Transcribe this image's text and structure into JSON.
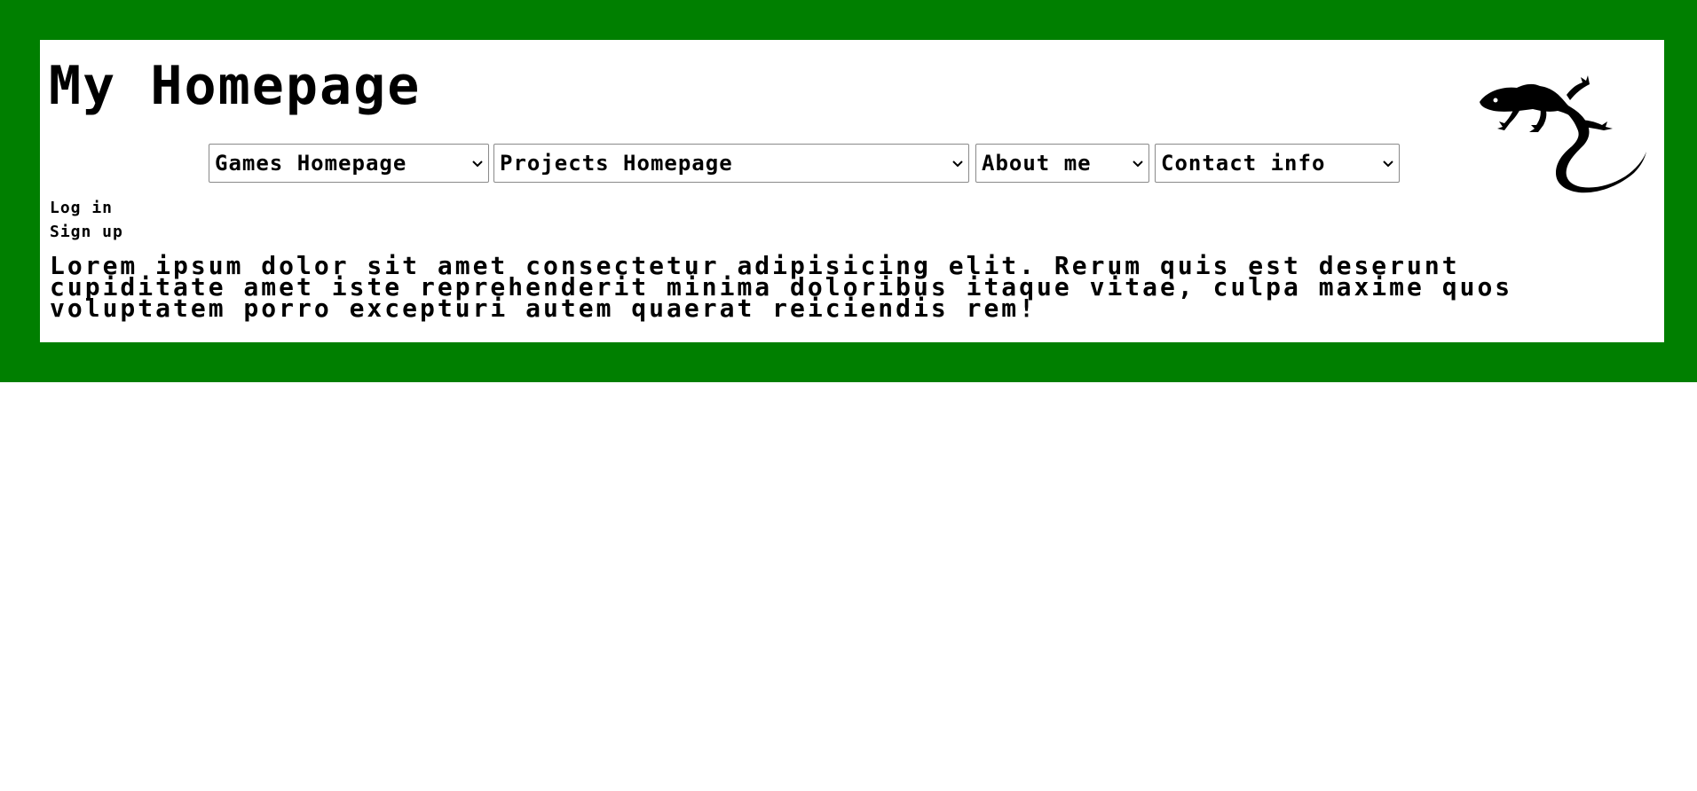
{
  "header": {
    "title": "My Homepage",
    "logo_icon": "lizard-icon"
  },
  "nav": {
    "items": [
      {
        "label": "Games Homepage"
      },
      {
        "label": "Projects Homepage"
      },
      {
        "label": "About me"
      },
      {
        "label": "Contact info"
      }
    ]
  },
  "auth": {
    "login_label": "Log in",
    "signup_label": "Sign up"
  },
  "content": {
    "text": "Lorem ipsum dolor sit amet consectetur adipisicing elit. Rerum quis est deserunt cupiditate amet iste reprehenderit minima doloribus itaque vitae, culpa maxime quos voluptatem porro excepturi autem quaerat reiciendis rem!"
  },
  "colors": {
    "frame": "#007f00",
    "panel": "#ffffff",
    "text": "#000000"
  }
}
